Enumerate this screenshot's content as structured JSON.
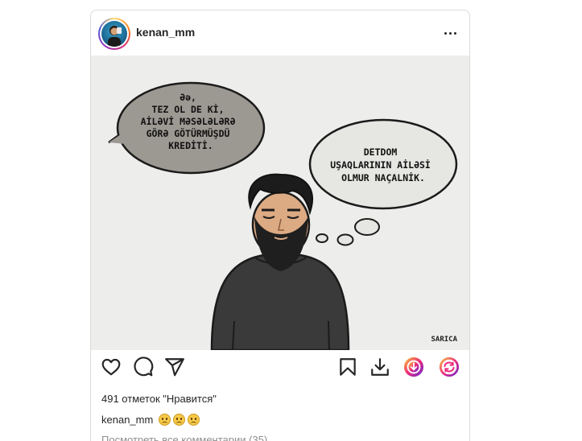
{
  "post": {
    "username": "kenan_mm",
    "more_icon": "more-horizontal-icon",
    "likes_text": "491 отметок \"Нравится\"",
    "caption_user": "kenan_mm",
    "caption_emojis": [
      "worried-face-emoji",
      "worried-face-emoji",
      "worried-face-emoji"
    ],
    "view_comments": "Посмотреть все комментарии (35)"
  },
  "media": {
    "bubble_left_lines": [
      "Əə,",
      "TEZ OL DE Kİ,",
      "AİLƏVİ MƏSƏLƏLƏRƏ",
      "GÖRƏ GÖTÜRMÜŞDÜ",
      "KREDİTİ."
    ],
    "bubble_right_lines": [
      "DETDOM",
      "UŞAQLARININ AİLƏSİ",
      "OLMUR NAÇALNİK."
    ],
    "signature": "SARICA"
  },
  "actions": {
    "like_icon": "heart-icon",
    "comment_icon": "comment-icon",
    "share_icon": "send-icon",
    "save_icon": "bookmark-icon",
    "download_icon": "download-icon",
    "ext_download_icon": "download-circle-icon",
    "ext_repost_icon": "repost-circle-icon"
  }
}
